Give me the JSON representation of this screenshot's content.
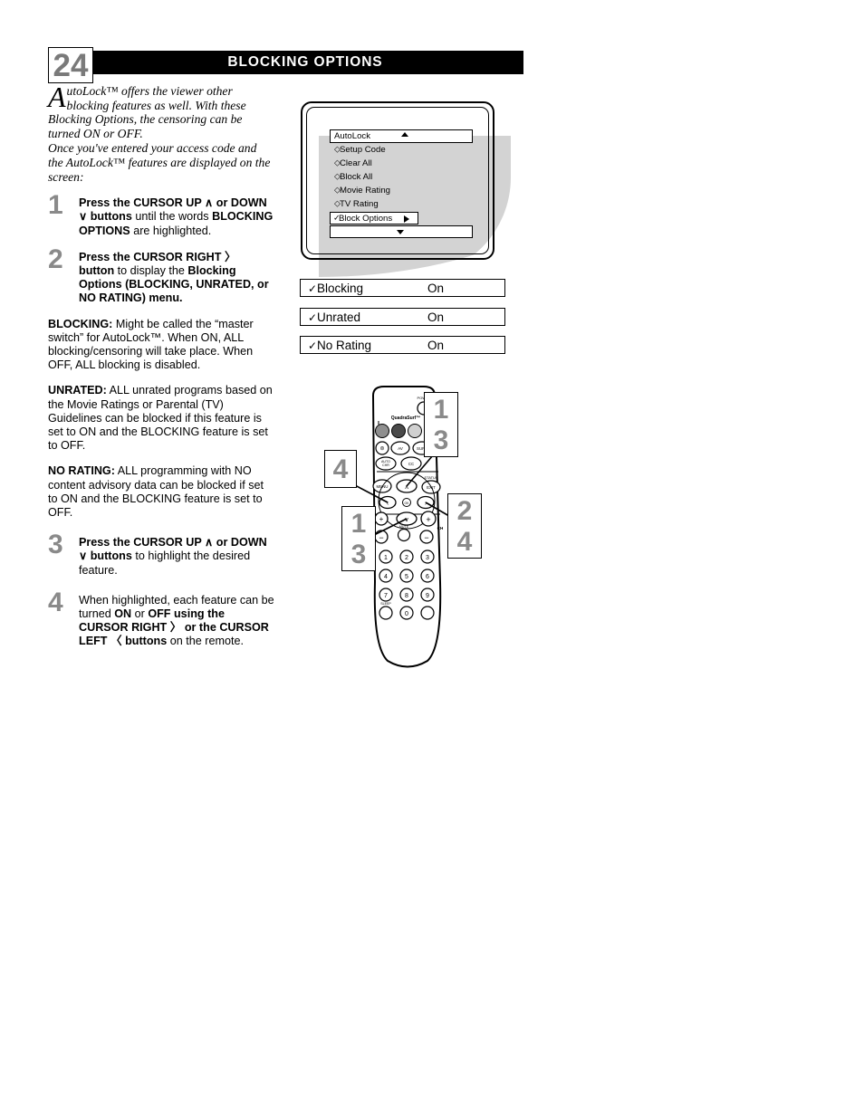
{
  "header": {
    "page_number": "24",
    "title": "BLOCKING OPTIONS"
  },
  "intro": {
    "dropcap": "A",
    "paragraph_1": "utoLock™ offers the viewer other blocking features as well. With these Blocking Options, the censoring can be turned ON or OFF.",
    "paragraph_2": "Once you've entered your access code and the AutoLock™ features are displayed on the screen:"
  },
  "steps": [
    {
      "number": "1",
      "parts": [
        {
          "t": "Press the ",
          "b": true
        },
        {
          "t": "CURSOR UP ",
          "b": true
        },
        {
          "t": "∧",
          "b": true
        },
        {
          "t": " or ",
          "b": true
        },
        {
          "t": "DOWN ",
          "b": true
        },
        {
          "t": "∨",
          "b": true
        },
        {
          "t": " buttons ",
          "b": true
        },
        {
          "t": "until the words ",
          "b": false
        },
        {
          "t": "BLOCKING OPTIONS ",
          "b": true
        },
        {
          "t": "are highlighted.",
          "b": false
        }
      ]
    },
    {
      "number": "2",
      "parts": [
        {
          "t": "Press the ",
          "b": true
        },
        {
          "t": "CURSOR RIGHT ",
          "b": true
        },
        {
          "t": "〉",
          "b": true
        },
        {
          "t": " button ",
          "b": true
        },
        {
          "t": "to display the ",
          "b": false
        },
        {
          "t": "Blocking Options (BLOCKING, UNRATED, or NO RATING) menu.",
          "b": true
        }
      ]
    },
    {
      "number": "3",
      "parts": [
        {
          "t": "Press the ",
          "b": true
        },
        {
          "t": "CURSOR UP ",
          "b": true
        },
        {
          "t": "∧",
          "b": true
        },
        {
          "t": " or ",
          "b": true
        },
        {
          "t": "DOWN ",
          "b": true
        },
        {
          "t": "∨",
          "b": true
        },
        {
          "t": " buttons ",
          "b": true
        },
        {
          "t": "to highlight the desired feature.",
          "b": false
        }
      ]
    },
    {
      "number": "4",
      "parts": [
        {
          "t": "When highlighted, each feature can be turned ",
          "b": false
        },
        {
          "t": "ON ",
          "b": true
        },
        {
          "t": "or ",
          "b": false
        },
        {
          "t": "OFF using the CURSOR RIGHT ",
          "b": true
        },
        {
          "t": "〉",
          "b": true
        },
        {
          "t": " or the CURSOR LEFT ",
          "b": true
        },
        {
          "t": "〈",
          "b": true
        },
        {
          "t": " buttons ",
          "b": true
        },
        {
          "t": "on the remote.",
          "b": false
        }
      ]
    }
  ],
  "definitions": [
    {
      "term": "BLOCKING:",
      "body": " Might be called the “master switch” for AutoLock™. When ON, ALL blocking/censoring will take place. When OFF, ALL blocking is disabled."
    },
    {
      "term": "UNRATED:",
      "body": " ALL unrated programs based on the Movie Ratings or Parental (TV) Guidelines can be blocked if this feature is set to ON and the BLOCKING feature is set to OFF."
    },
    {
      "term": "NO RATING:",
      "body": " ALL programming with NO content advisory data can be blocked if set to ON and the BLOCKING feature is set to OFF."
    }
  ],
  "tv_menu": {
    "title": "AutoLock",
    "title_arrow": "up-arrow",
    "items": [
      {
        "marker": "◇",
        "label": "Setup Code"
      },
      {
        "marker": "◇",
        "label": "Clear All"
      },
      {
        "marker": "◇",
        "label": "Block All"
      },
      {
        "marker": "◇",
        "label": "Movie Rating"
      },
      {
        "marker": "◇",
        "label": "TV Rating"
      }
    ],
    "selected": {
      "marker": "✓",
      "label": "Block Options",
      "arrow": "right-arrow"
    },
    "scroll_down_arrow": "down-arrow"
  },
  "status_bars": [
    {
      "check": "✓",
      "label": "Blocking",
      "value": "On"
    },
    {
      "check": "✓",
      "label": "Unrated",
      "value": "On"
    },
    {
      "check": "✓",
      "label": "No Rating",
      "value": "On"
    }
  ],
  "remote": {
    "brand_label": "QuadraSurf™",
    "power_label": "POWER",
    "status_label": "STATUS",
    "exit_label": "EXIT",
    "menu_label": "MENU",
    "mute_label": "MUTE",
    "ch_label": "CH",
    "sleep_label": "SLEEP",
    "auto_chr_label": "AUTO\nCHR",
    "cc_label": "CC",
    "av_label": "AV",
    "surf_label": "SURF",
    "keypad": [
      "1",
      "2",
      "3",
      "4",
      "5",
      "6",
      "7",
      "8",
      "9",
      "0"
    ],
    "cursor_up": "∧",
    "cursor_down": "∨",
    "cursor_left": "‹",
    "cursor_right": "›",
    "ok_label": "OK",
    "vol_plus": "+",
    "vol_minus": "−",
    "ch_plus": "+",
    "ch_minus": "−",
    "quadra_colors": [
      "#8f8f8f",
      "#4a4a4a",
      "#d0d0d0",
      "#000000"
    ]
  },
  "callouts": [
    {
      "id": "callout-top-right",
      "lines": [
        "1",
        "3"
      ]
    },
    {
      "id": "callout-left",
      "lines": [
        "4"
      ]
    },
    {
      "id": "callout-bottom-left",
      "lines": [
        "1",
        "3"
      ]
    },
    {
      "id": "callout-bottom-right",
      "lines": [
        "2",
        "4"
      ]
    }
  ],
  "colors": {
    "header_band": "#000000",
    "page_number": "#7a7a7a",
    "step_number": "#8a8a8a",
    "callout_number": "#8a8a8a",
    "tv_shadow": "#d3d3d3"
  }
}
